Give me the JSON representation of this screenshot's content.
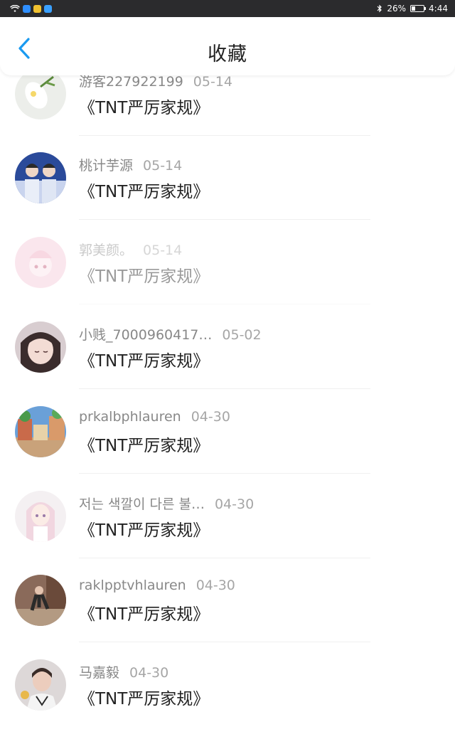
{
  "status_bar": {
    "battery": "26%",
    "time": "4:44",
    "battery_level": 0.26
  },
  "header": {
    "title": "收藏"
  },
  "items": [
    {
      "user": "游客227922199",
      "date": "05-14",
      "title": "《TNT严厉家规》"
    },
    {
      "user": "桃计芋源",
      "date": "05-14",
      "title": "《TNT严厉家规》"
    },
    {
      "user": "郭美颜。",
      "date": "05-14",
      "title": "《TNT严厉家规》"
    },
    {
      "user": "小贱_7000960417…",
      "date": "05-02",
      "title": "《TNT严厉家规》"
    },
    {
      "user": "prkalbphlauren",
      "date": "04-30",
      "title": "《TNT严厉家规》"
    },
    {
      "user": "저는 색깔이 다른 불…",
      "date": "04-30",
      "title": "《TNT严厉家规》"
    },
    {
      "user": "raklpptvhlauren",
      "date": "04-30",
      "title": "《TNT严厉家规》"
    },
    {
      "user": "马嘉毅",
      "date": "04-30",
      "title": "《TNT严厉家规》"
    }
  ],
  "colors": {
    "accent": "#1a9af0",
    "status_bar_bg": "#2b2b2d",
    "title_text": "#222222",
    "meta_text": "#888888"
  }
}
